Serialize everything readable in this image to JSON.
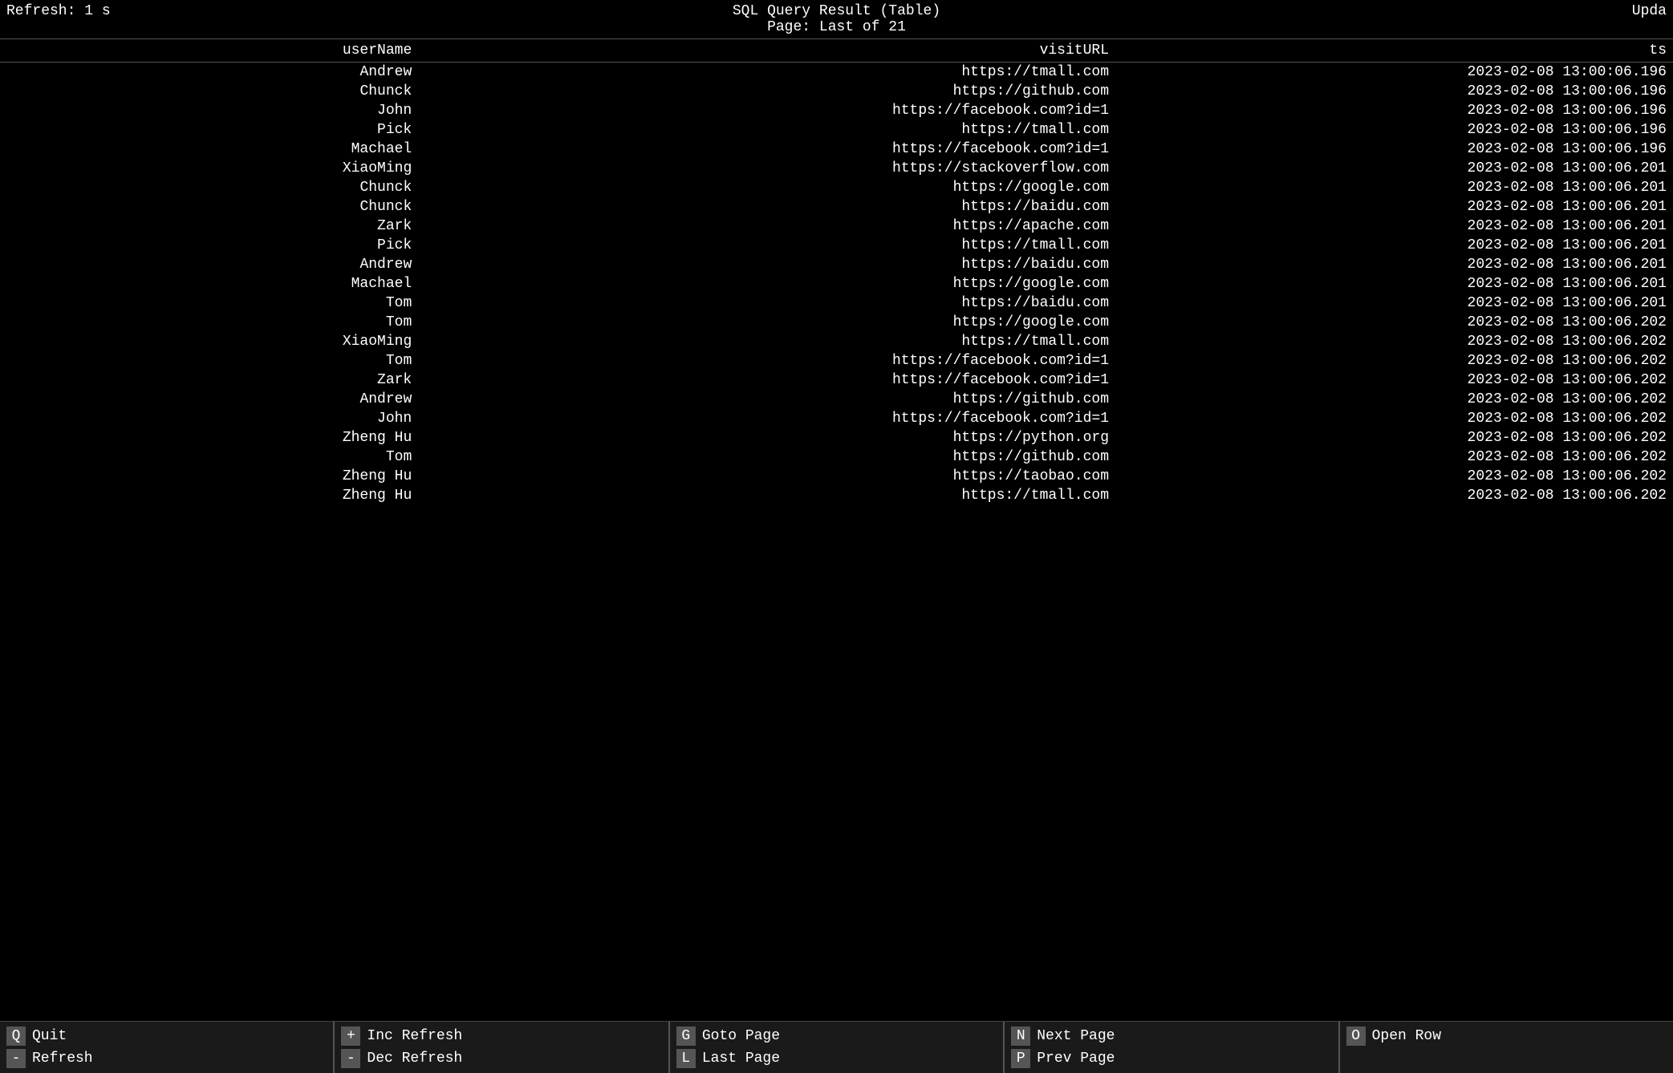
{
  "header": {
    "title": "SQL Query Result (Table)",
    "refresh_label": "Refresh: 1 s",
    "page_label": "Page: Last of 21",
    "update_label": "Upda"
  },
  "table": {
    "columns": [
      {
        "key": "userName",
        "label": "userName"
      },
      {
        "key": "visitURL",
        "label": "visitURL"
      },
      {
        "key": "ts",
        "label": "ts"
      }
    ],
    "rows": [
      {
        "userName": "Andrew",
        "visitURL": "https://tmall.com",
        "ts": "2023-02-08 13:00:06.196"
      },
      {
        "userName": "Chunck",
        "visitURL": "https://github.com",
        "ts": "2023-02-08 13:00:06.196"
      },
      {
        "userName": "John",
        "visitURL": "https://facebook.com?id=1",
        "ts": "2023-02-08 13:00:06.196"
      },
      {
        "userName": "Pick",
        "visitURL": "https://tmall.com",
        "ts": "2023-02-08 13:00:06.196"
      },
      {
        "userName": "Machael",
        "visitURL": "https://facebook.com?id=1",
        "ts": "2023-02-08 13:00:06.196"
      },
      {
        "userName": "XiaoMing",
        "visitURL": "https://stackoverflow.com",
        "ts": "2023-02-08 13:00:06.201"
      },
      {
        "userName": "Chunck",
        "visitURL": "https://google.com",
        "ts": "2023-02-08 13:00:06.201"
      },
      {
        "userName": "Chunck",
        "visitURL": "https://baidu.com",
        "ts": "2023-02-08 13:00:06.201"
      },
      {
        "userName": "Zark",
        "visitURL": "https://apache.com",
        "ts": "2023-02-08 13:00:06.201"
      },
      {
        "userName": "Pick",
        "visitURL": "https://tmall.com",
        "ts": "2023-02-08 13:00:06.201"
      },
      {
        "userName": "Andrew",
        "visitURL": "https://baidu.com",
        "ts": "2023-02-08 13:00:06.201"
      },
      {
        "userName": "Machael",
        "visitURL": "https://google.com",
        "ts": "2023-02-08 13:00:06.201"
      },
      {
        "userName": "Tom",
        "visitURL": "https://baidu.com",
        "ts": "2023-02-08 13:00:06.201"
      },
      {
        "userName": "Tom",
        "visitURL": "https://google.com",
        "ts": "2023-02-08 13:00:06.202"
      },
      {
        "userName": "XiaoMing",
        "visitURL": "https://tmall.com",
        "ts": "2023-02-08 13:00:06.202"
      },
      {
        "userName": "Tom",
        "visitURL": "https://facebook.com?id=1",
        "ts": "2023-02-08 13:00:06.202"
      },
      {
        "userName": "Zark",
        "visitURL": "https://facebook.com?id=1",
        "ts": "2023-02-08 13:00:06.202"
      },
      {
        "userName": "Andrew",
        "visitURL": "https://github.com",
        "ts": "2023-02-08 13:00:06.202"
      },
      {
        "userName": "John",
        "visitURL": "https://facebook.com?id=1",
        "ts": "2023-02-08 13:00:06.202"
      },
      {
        "userName": "Zheng Hu",
        "visitURL": "https://python.org",
        "ts": "2023-02-08 13:00:06.202"
      },
      {
        "userName": "Tom",
        "visitURL": "https://github.com",
        "ts": "2023-02-08 13:00:06.202"
      },
      {
        "userName": "Zheng Hu",
        "visitURL": "https://taobao.com",
        "ts": "2023-02-08 13:00:06.202"
      },
      {
        "userName": "Zheng Hu",
        "visitURL": "https://tmall.com",
        "ts": "2023-02-08 13:00:06.202"
      }
    ]
  },
  "footer": {
    "sections": [
      {
        "items": [
          {
            "key": "Q",
            "label": "Quit"
          },
          {
            "key": "-",
            "label": "Refresh"
          }
        ]
      },
      {
        "items": [
          {
            "key": "+",
            "label": "Inc Refresh"
          },
          {
            "key": "-",
            "label": "Dec Refresh"
          }
        ]
      },
      {
        "items": [
          {
            "key": "G",
            "label": "Goto Page"
          },
          {
            "key": "L",
            "label": "Last Page"
          }
        ]
      },
      {
        "items": [
          {
            "key": "N",
            "label": "Next Page"
          },
          {
            "key": "P",
            "label": "Prev Page"
          }
        ]
      },
      {
        "items": [
          {
            "key": "O",
            "label": "Open Row"
          }
        ]
      }
    ]
  }
}
